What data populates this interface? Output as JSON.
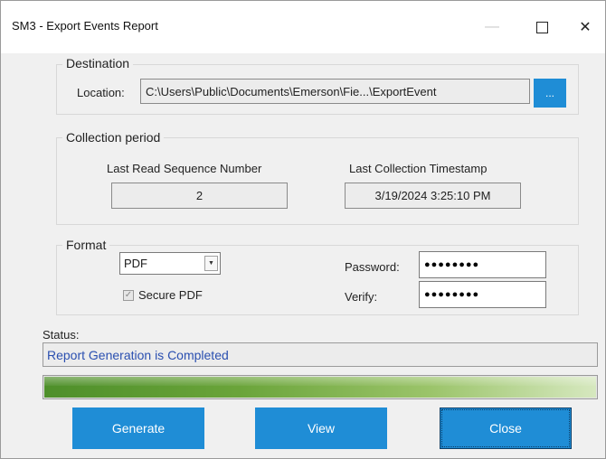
{
  "window": {
    "title": "SM3 - Export Events Report",
    "controls": {
      "minimize": "—",
      "maximize": "",
      "close": "✕"
    }
  },
  "destination": {
    "legend": "Destination",
    "location_label": "Location:",
    "location_value": "C:\\Users\\Public\\Documents\\Emerson\\Fie...\\ExportEvent",
    "browse_label": "..."
  },
  "collection": {
    "legend": "Collection period",
    "seq_label": "Last Read Sequence Number",
    "seq_value": "2",
    "ts_label": "Last Collection Timestamp",
    "ts_value": "3/19/2024 3:25:10 PM"
  },
  "format": {
    "legend": "Format",
    "selected": "PDF",
    "secure_label": "Secure PDF",
    "secure_checked": true,
    "password_label": "Password:",
    "password_value": "●●●●●●●●",
    "verify_label": "Verify:",
    "verify_value": "●●●●●●●●"
  },
  "status": {
    "label": "Status:",
    "message": "Report Generation is Completed",
    "progress_fraction": 1.0
  },
  "buttons": {
    "generate": "Generate",
    "view": "View",
    "close": "Close"
  },
  "colors": {
    "accent": "#1f8dd6",
    "status_text": "#2a4fb0",
    "progress": "#6aa43a"
  }
}
